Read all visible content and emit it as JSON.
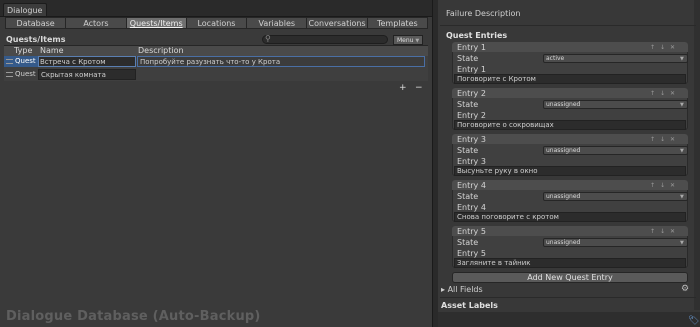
{
  "window": {
    "tab_title": "Dialogue"
  },
  "toolbar": {
    "tabs": [
      "Database",
      "Actors",
      "Quests/Items",
      "Locations",
      "Variables",
      "Conversations",
      "Templates"
    ],
    "active_index": 2
  },
  "quests_section": {
    "title": "Quests/Items",
    "menu_label": "Menu"
  },
  "table": {
    "headers": {
      "type": "Type",
      "name": "Name",
      "description": "Description"
    },
    "rows": [
      {
        "type": "Quest",
        "name": "Встреча с Кротом",
        "description": "Попробуйте разузнать что-то у Крота"
      },
      {
        "type": "Quest",
        "name": "Скрытая комната",
        "description": ""
      }
    ],
    "add_label": "+",
    "remove_label": "−"
  },
  "footer": {
    "title": "Dialogue Database (Auto-Backup)"
  },
  "inspector": {
    "failure_description_label": "Failure Description",
    "quest_entries_title": "Quest Entries",
    "state_label": "State",
    "entries": [
      {
        "header": "Entry 1",
        "state": "active",
        "text_label": "Entry 1",
        "text": "Поговорите с Кротом"
      },
      {
        "header": "Entry 2",
        "state": "unassigned",
        "text_label": "Entry 2",
        "text": "Поговорите о сокровищах"
      },
      {
        "header": "Entry 3",
        "state": "unassigned",
        "text_label": "Entry 3",
        "text": "Высуньте руку в окно"
      },
      {
        "header": "Entry 4",
        "state": "unassigned",
        "text_label": "Entry 4",
        "text": "Снова поговорите с кротом"
      },
      {
        "header": "Entry 5",
        "state": "unassigned",
        "text_label": "Entry 5",
        "text": "Загляните в тайник"
      }
    ],
    "add_entry_label": "Add New Quest Entry",
    "all_fields_label": "All Fields",
    "asset_labels_title": "Asset Labels"
  },
  "colors": {
    "selection": "#355a8a",
    "panel": "#3a3a3a",
    "inspector": "#383838"
  }
}
